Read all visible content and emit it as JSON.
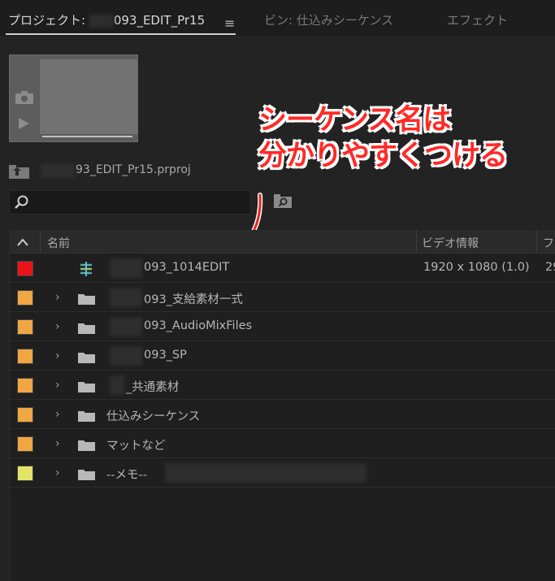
{
  "tabs": [
    {
      "label": "プロジェクト: ",
      "name_visible": "093_EDIT_Pr15",
      "active": true
    },
    {
      "label": "ビン: 仕込みシーケンス",
      "active": false
    },
    {
      "label": "エフェクト",
      "active": false
    }
  ],
  "tab_menu_icon": "hamburger-icon",
  "project": {
    "filename_visible": "93_EDIT_Pr15.prproj"
  },
  "search": {
    "placeholder": "",
    "value": ""
  },
  "annotation": {
    "line1": "シーケンス名は",
    "line2": "分かりやすくつける",
    "color": "#ff2a26"
  },
  "table": {
    "columns": [
      "名前",
      "ビデオ情報",
      "フ"
    ],
    "rows": [
      {
        "name": "093_1014EDIT",
        "type": "sequence",
        "label_color": "#e8141a",
        "video": "1920 x 1080 (1.0)",
        "frame": "29"
      },
      {
        "name": "093_支給素材一式",
        "type": "folder",
        "label_color": "#f0a642",
        "video": "",
        "frame": ""
      },
      {
        "name": "093_AudioMixFiles",
        "type": "folder",
        "label_color": "#f0a642",
        "video": "",
        "frame": ""
      },
      {
        "name": "093_SP",
        "type": "folder",
        "label_color": "#f0a642",
        "video": "",
        "frame": ""
      },
      {
        "name": "_共通素材",
        "type": "folder",
        "label_color": "#f0a642",
        "video": "",
        "frame": ""
      },
      {
        "name": "仕込みシーケンス",
        "type": "folder",
        "label_color": "#f0a642",
        "video": "",
        "frame": ""
      },
      {
        "name": "マットなど",
        "type": "folder",
        "label_color": "#f0a642",
        "video": "",
        "frame": ""
      },
      {
        "name": "--メモ--",
        "type": "folder",
        "label_color": "#e3e36a",
        "video": "",
        "frame": ""
      }
    ]
  }
}
